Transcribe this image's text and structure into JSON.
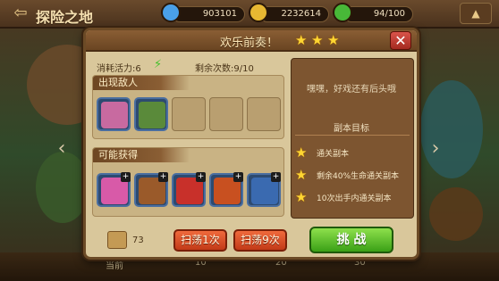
{
  "topbar": {
    "title": "探险之地",
    "resources": [
      {
        "icon": "blue-gem-icon",
        "value": "903101",
        "color": "#4aa0e8"
      },
      {
        "icon": "gold-coin-icon",
        "value": "2232614",
        "color": "#e8b832"
      },
      {
        "icon": "green-energy-icon",
        "value": "94/100",
        "color": "#48b838"
      }
    ]
  },
  "bottom_labels": [
    "当前",
    "10",
    "20",
    "30"
  ],
  "dialog": {
    "title": "欢乐前奏！",
    "stars": 3,
    "cost_label": "消耗活力:6",
    "remaining_label": "剩余次数:9/10",
    "enemies_section": "出现敌人",
    "rewards_section": "可能获得",
    "quote": "嘿嘿，好戏还有后头哦",
    "goals_title": "副本目标",
    "goals": [
      "通关副本",
      "剩余40%生命通关副本",
      "10次出手内通关副本"
    ],
    "scroll_count": "73",
    "sweep1_label": "扫荡1次",
    "sweep9_label": "扫荡9次",
    "fight_label": "挑 战"
  },
  "enemies": [
    {
      "name": "purple-hair-girl-portrait",
      "color": "#c86aa0"
    },
    {
      "name": "green-hat-warrior-portrait",
      "color": "#5a8a3a"
    }
  ],
  "rewards": [
    {
      "name": "pink-fairy-item",
      "color": "#d85aa8"
    },
    {
      "name": "brown-monkey-item",
      "color": "#9a5a2a"
    },
    {
      "name": "red-cannon-item",
      "color": "#c8302a"
    },
    {
      "name": "red-fox-item",
      "color": "#c85020"
    },
    {
      "name": "crown-shield-item",
      "color": "#3a6ab0"
    }
  ]
}
